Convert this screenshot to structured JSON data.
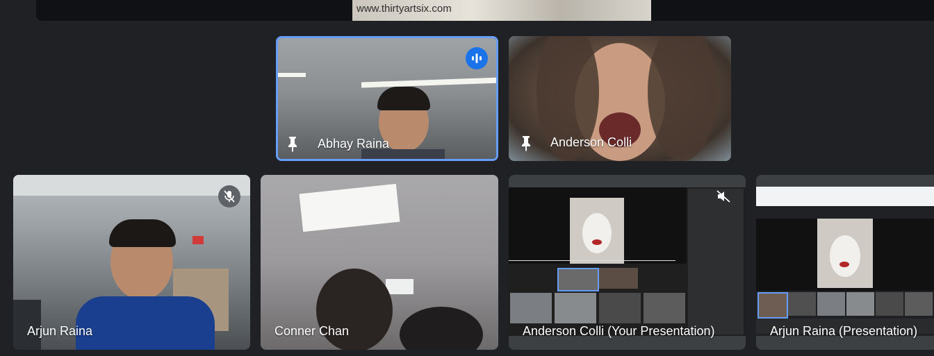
{
  "presentation_strip": {
    "watermark": "www.thirtyartsix.com"
  },
  "participants": [
    {
      "name": "Abhay Raina",
      "pinned": true,
      "speaking": true,
      "icon": "pin-icon"
    },
    {
      "name": "Anderson Colli",
      "pinned": true,
      "icon": "pin-icon"
    },
    {
      "name": "Arjun Raina",
      "muted": true,
      "icon": "mic-off-icon"
    },
    {
      "name": "Conner Chan"
    },
    {
      "name": "Anderson Colli (Your Presentation)",
      "muted": true,
      "icon": "speaker-off-icon"
    },
    {
      "name": "Arjun Raina (Presentation)"
    }
  ],
  "colors": {
    "background": "#202124",
    "active_speaker_border": "#669df6",
    "speaking_badge": "#1a73e8",
    "mute_badge": "#5f6368"
  }
}
